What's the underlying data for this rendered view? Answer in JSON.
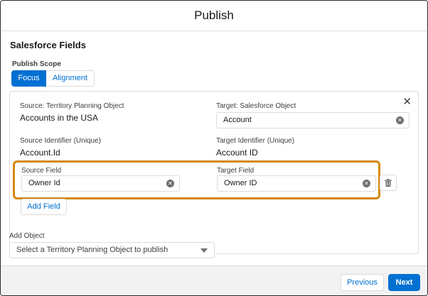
{
  "header": {
    "title": "Publish"
  },
  "section": {
    "title": "Salesforce Fields"
  },
  "scope": {
    "label": "Publish Scope",
    "options": [
      {
        "label": "Focus",
        "selected": true
      },
      {
        "label": "Alignment",
        "selected": false
      }
    ]
  },
  "mapping": {
    "source_label": "Source: Territory Planning Object",
    "source_value": "Accounts in the USA",
    "target_label": "Target: Salesforce Object",
    "target_value": "Account",
    "source_id_label": "Source Identifier (Unique)",
    "source_id_value": "Account.Id",
    "target_id_label": "Target Identifier (Unique)",
    "target_id_value": "Account ID",
    "source_field_label": "Source Field",
    "source_field_value": "Owner Id",
    "target_field_label": "Target Field",
    "target_field_value": "Owner ID",
    "add_field_label": "Add Field"
  },
  "add_object": {
    "label": "Add Object",
    "placeholder": "Select a Territory Planning Object to publish"
  },
  "footer": {
    "previous_label": "Previous",
    "next_label": "Next"
  },
  "colors": {
    "brand": "#0070d2",
    "highlight": "#d4890b"
  },
  "icons": {
    "close": "close-icon",
    "clear": "clear-icon",
    "delete": "trash-icon",
    "dropdown": "chevron-down-icon"
  }
}
